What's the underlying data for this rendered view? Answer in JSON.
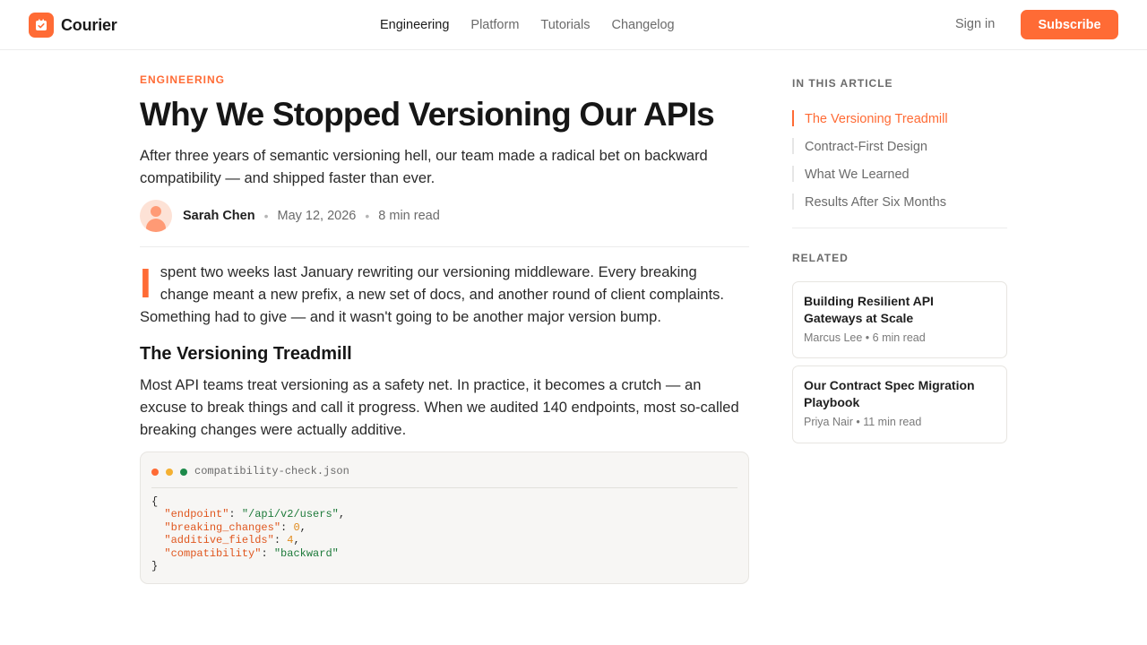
{
  "brand": {
    "name": "Courier",
    "color": "#ff6b35",
    "icon": "check-square-icon"
  },
  "nav": {
    "items": [
      {
        "label": "Engineering",
        "active": true
      },
      {
        "label": "Platform",
        "active": false
      },
      {
        "label": "Tutorials",
        "active": false
      },
      {
        "label": "Changelog",
        "active": false
      }
    ],
    "signin_label": "Sign in",
    "subscribe_label": "Subscribe"
  },
  "article": {
    "category": "ENGINEERING",
    "title": "Why We Stopped Versioning Our APIs",
    "subtitle": "After three years of semantic versioning hell, our team made a radical bet on backward compatibility — and shipped faster than ever.",
    "author": "Sarah Chen",
    "date": "May 12, 2026",
    "read_time": "8 min read",
    "lead_dropcap": "I",
    "lead_rest": "spent two weeks last January rewriting our versioning middleware. Every breaking change meant a new prefix, a new set of docs, and another round of client complaints. Something had to give — and it wasn't going to be another major version bump.",
    "section_heading": "The Versioning Treadmill",
    "section_body": "Most API teams treat versioning as a safety net. In practice, it becomes a crutch — an excuse to break things and call it progress. When we audited 140 endpoints, most so-called breaking changes were actually additive.",
    "code": {
      "filename": "compatibility-check.json",
      "lines": {
        "open": "{",
        "k1": "\"endpoint\"",
        "v1": "\"/api/v2/users\"",
        "k2": "\"breaking_changes\"",
        "v2": "0",
        "k3": "\"additive_fields\"",
        "v3": "4",
        "k4": "\"compatibility\"",
        "v4": "\"backward\"",
        "close": "}"
      }
    }
  },
  "sidebar": {
    "toc_label": "IN THIS ARTICLE",
    "toc": [
      {
        "label": "The Versioning Treadmill",
        "active": true
      },
      {
        "label": "Contract-First Design",
        "active": false
      },
      {
        "label": "What We Learned",
        "active": false
      },
      {
        "label": "Results After Six Months",
        "active": false
      }
    ],
    "related_label": "RELATED",
    "related": [
      {
        "title": "Building Resilient API Gateways at Scale",
        "author": "Marcus Lee",
        "read_time": "6 min read"
      },
      {
        "title": "Our Contract Spec Migration Playbook",
        "author": "Priya Nair",
        "read_time": "11 min read"
      }
    ]
  },
  "colors": {
    "accent": "#ff6b35",
    "text": "#1f1f1f",
    "muted": "#6b6b6b",
    "code_key": "#e0571f",
    "code_string": "#1d7a3a",
    "code_number": "#e08a1c"
  }
}
